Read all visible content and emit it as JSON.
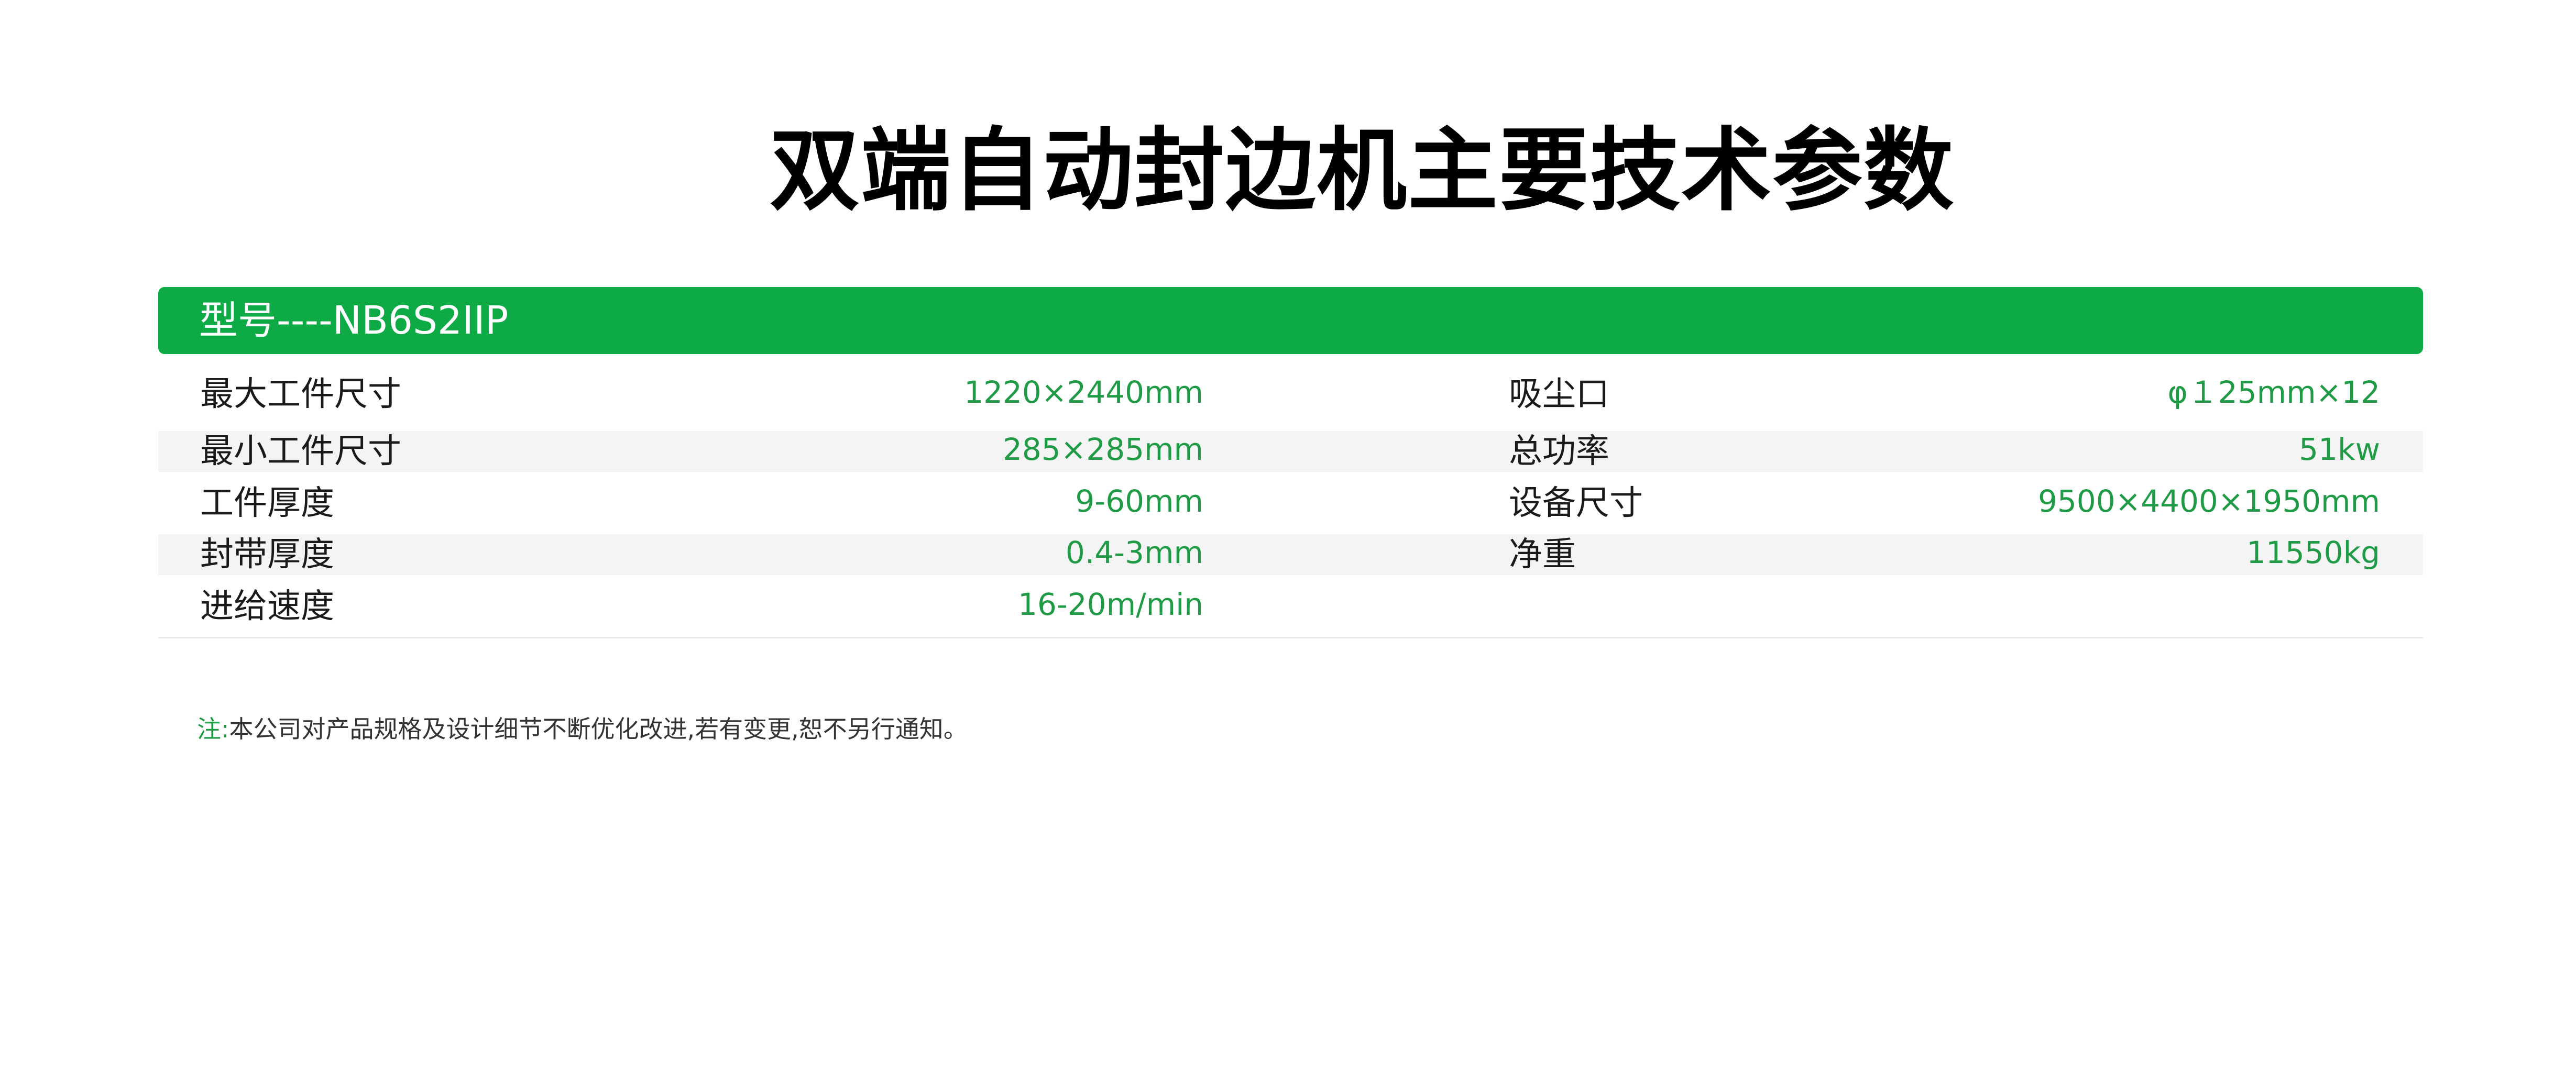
{
  "title": "双端自动封边机主要技术参数",
  "model": "型号----NB6S2IIP",
  "rows": [
    {
      "left": {
        "label": "最大工件尺寸",
        "value": "1220×2440mm"
      },
      "right": {
        "label": "吸尘口",
        "value": "φ１25mm×12"
      }
    },
    {
      "left": {
        "label": "最小工件尺寸",
        "value": "285×285mm"
      },
      "right": {
        "label": "总功率",
        "value": "51kw"
      }
    },
    {
      "left": {
        "label": "工件厚度",
        "value": "9-60mm"
      },
      "right": {
        "label": "设备尺寸",
        "value": "9500×4400×1950mm"
      }
    },
    {
      "left": {
        "label": "封带厚度",
        "value": "0.4-3mm"
      },
      "right": {
        "label": "净重",
        "value": "11550kg"
      }
    },
    {
      "left": {
        "label": "进给速度",
        "value": "16-20m/min"
      },
      "right": {
        "label": "",
        "value": ""
      }
    }
  ],
  "footnote": {
    "mark": "注:",
    "text": "本公司对产品规格及设计细节不断优化改进,若有变更,恕不另行通知。"
  },
  "colors": {
    "accent": "#0eaa46",
    "value_text": "#1f9a45",
    "shaded_row": "#f4f4f4"
  }
}
